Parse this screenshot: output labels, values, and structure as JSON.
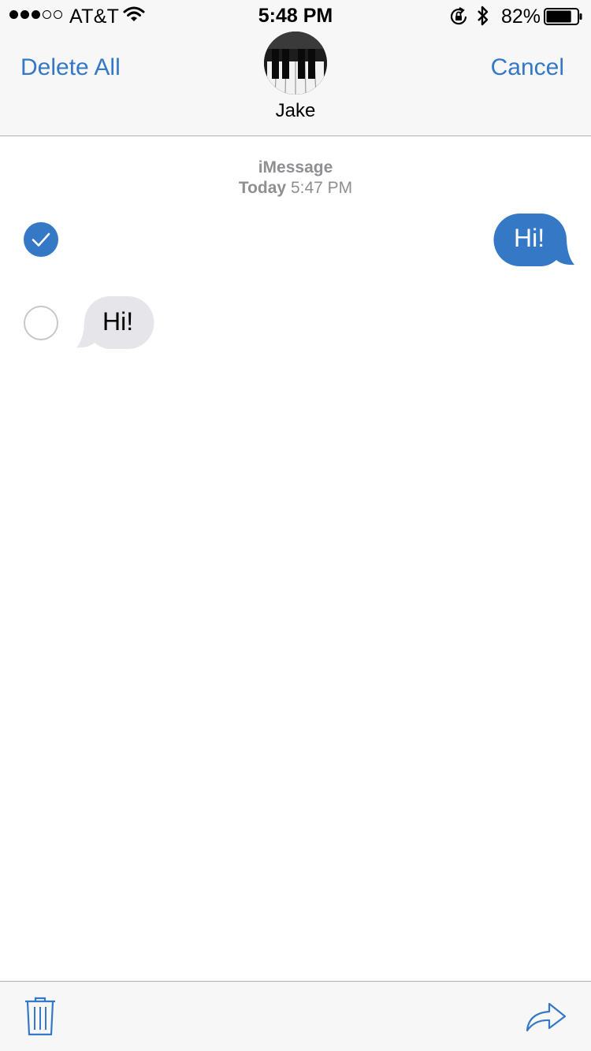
{
  "status_bar": {
    "signal_bars_filled": 3,
    "signal_bars_total": 5,
    "carrier": "AT&T",
    "wifi_icon": "wifi-icon",
    "time": "5:48 PM",
    "rotation_lock_icon": "rotation-lock-icon",
    "bluetooth_icon": "bluetooth-icon",
    "battery_percent": "82%",
    "battery_level": 0.82
  },
  "header": {
    "left_button": "Delete All",
    "right_button": "Cancel",
    "contact_name": "Jake",
    "avatar_icon": "piano-keys-avatar"
  },
  "conversation": {
    "service_label": "iMessage",
    "date_label": "Today",
    "time_label": "5:47 PM",
    "messages": [
      {
        "direction": "outgoing",
        "text": "Hi!",
        "selected": true
      },
      {
        "direction": "incoming",
        "text": "Hi!",
        "selected": false
      }
    ]
  },
  "toolbar": {
    "left_icon": "trash-icon",
    "right_icon": "share-forward-icon"
  },
  "colors": {
    "accent": "#3478c6",
    "outgoing_bubble": "#3478c6",
    "incoming_bubble": "#e5e5ea",
    "meta_text": "#8e8e93",
    "bar_background": "#f7f7f7"
  }
}
